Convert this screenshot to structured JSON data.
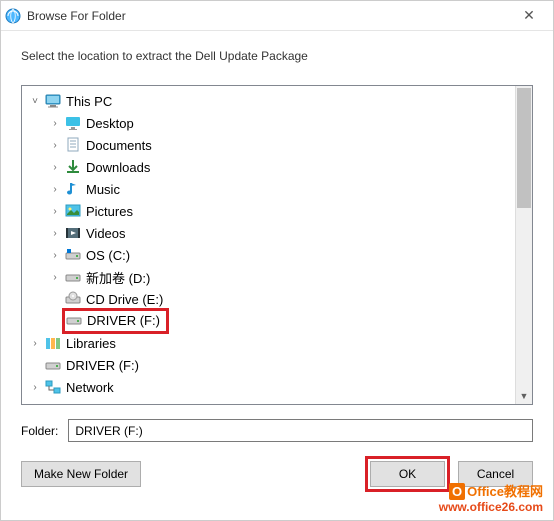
{
  "titlebar": {
    "title": "Browse For Folder"
  },
  "instruction": "Select the location to extract the Dell Update Package",
  "tree": {
    "root": {
      "label": "This PC"
    },
    "items": [
      {
        "label": "Desktop"
      },
      {
        "label": "Documents"
      },
      {
        "label": "Downloads"
      },
      {
        "label": "Music"
      },
      {
        "label": "Pictures"
      },
      {
        "label": "Videos"
      },
      {
        "label": "OS (C:)"
      },
      {
        "label": "新加卷 (D:)"
      },
      {
        "label": "CD Drive (E:)"
      },
      {
        "label": "DRIVER (F:)"
      }
    ],
    "libraries": {
      "label": "Libraries"
    },
    "driver_root": {
      "label": "DRIVER (F:)"
    },
    "network": {
      "label": "Network"
    }
  },
  "folder": {
    "label": "Folder:",
    "value": "DRIVER (F:)"
  },
  "buttons": {
    "make_new": "Make New Folder",
    "ok": "OK",
    "cancel": "Cancel"
  },
  "watermark": {
    "brand": "Office教程网",
    "url": "www.office26.com"
  }
}
